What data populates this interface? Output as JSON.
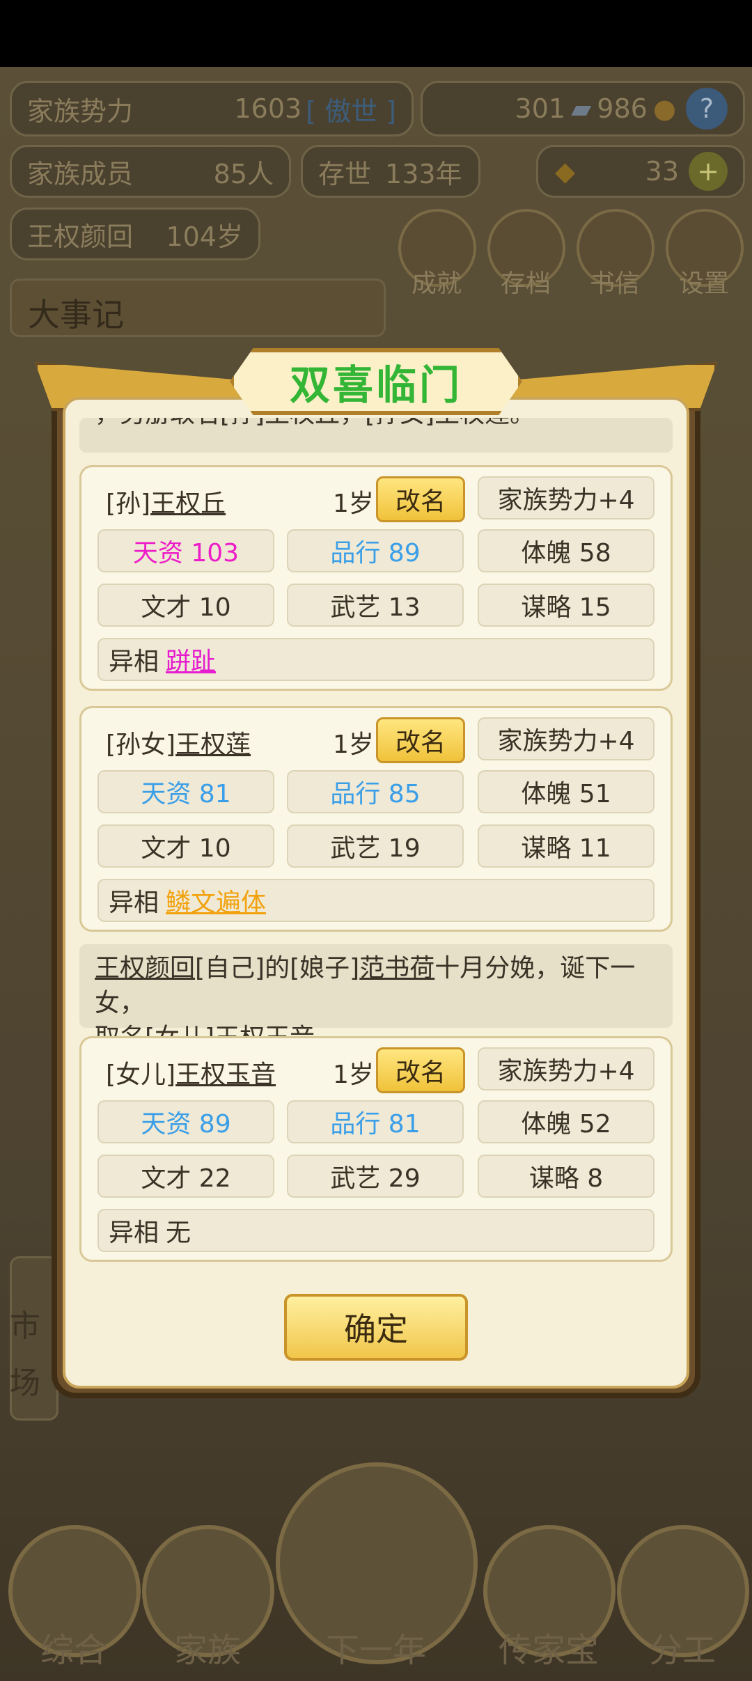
{
  "hud": {
    "power_label": "家族势力",
    "power_value": "1603",
    "power_rank": "[ 傲世 ]",
    "silver": "301",
    "coins": "986",
    "members_label": "家族成员",
    "members_value": "85人",
    "exist_label": "存世",
    "exist_value": "133年",
    "gold": "33",
    "patriarch_name": "王权颜回",
    "patriarch_age": "104岁",
    "buttons": [
      "成就",
      "存档",
      "书信",
      "设置"
    ],
    "events_title": "大事记",
    "market": [
      "市",
      "场"
    ]
  },
  "bottom_nav": [
    "综合",
    "家族",
    "下一年",
    "传家宝",
    "分工"
  ],
  "dialog": {
    "title": "双喜临门",
    "top_partial": "，另册取名[孙]王权丘，[孙女]王权莲。",
    "cards": [
      {
        "relation": "[孙]",
        "name": "王权丘",
        "age": "1岁",
        "rename_label": "改名",
        "bonus": "家族势力+4",
        "stats_row1": [
          {
            "text": "天资 103",
            "color": "#ee1cc8"
          },
          {
            "text": "品行 89",
            "color": "#3a9ee8"
          },
          {
            "text": "体魄 58",
            "color": "#3a3226"
          }
        ],
        "stats_row2": [
          "文才 10",
          "武艺 13",
          "谋略 15"
        ],
        "trait_label": "异相",
        "trait": "跰趾",
        "trait_color": "#e61ccf"
      },
      {
        "relation": "[孙女]",
        "name": "王权莲",
        "age": "1岁",
        "rename_label": "改名",
        "bonus": "家族势力+4",
        "stats_row1": [
          {
            "text": "天资 81",
            "color": "#3a9ee8"
          },
          {
            "text": "品行 85",
            "color": "#3a9ee8"
          },
          {
            "text": "体魄 51",
            "color": "#3a3226"
          }
        ],
        "stats_row2": [
          "文才 10",
          "武艺 19",
          "谋略 11"
        ],
        "trait_label": "异相",
        "trait": "鳞文遍体",
        "trait_color": "#f2a20f"
      },
      {
        "relation": "[女儿]",
        "name": "王权玉音",
        "age": "1岁",
        "rename_label": "改名",
        "bonus": "家族势力+4",
        "stats_row1": [
          {
            "text": "天资 89",
            "color": "#3a9ee8"
          },
          {
            "text": "品行 81",
            "color": "#3a9ee8"
          },
          {
            "text": "体魄 52",
            "color": "#3a3226"
          }
        ],
        "stats_row2": [
          "文才 22",
          "武艺 29",
          "谋略 8"
        ],
        "trait_label": "异相",
        "trait": "无",
        "trait_color": "#3a3226"
      }
    ],
    "message": {
      "p1": "王权颜回",
      "p2": "[自己]的[娘子]",
      "p3": "范书荷",
      "p4": "十月分娩，诞下一女，",
      "p5": "取名[女儿]",
      "p6": "王权玉音",
      "p7": "。"
    },
    "confirm_label": "确定"
  }
}
